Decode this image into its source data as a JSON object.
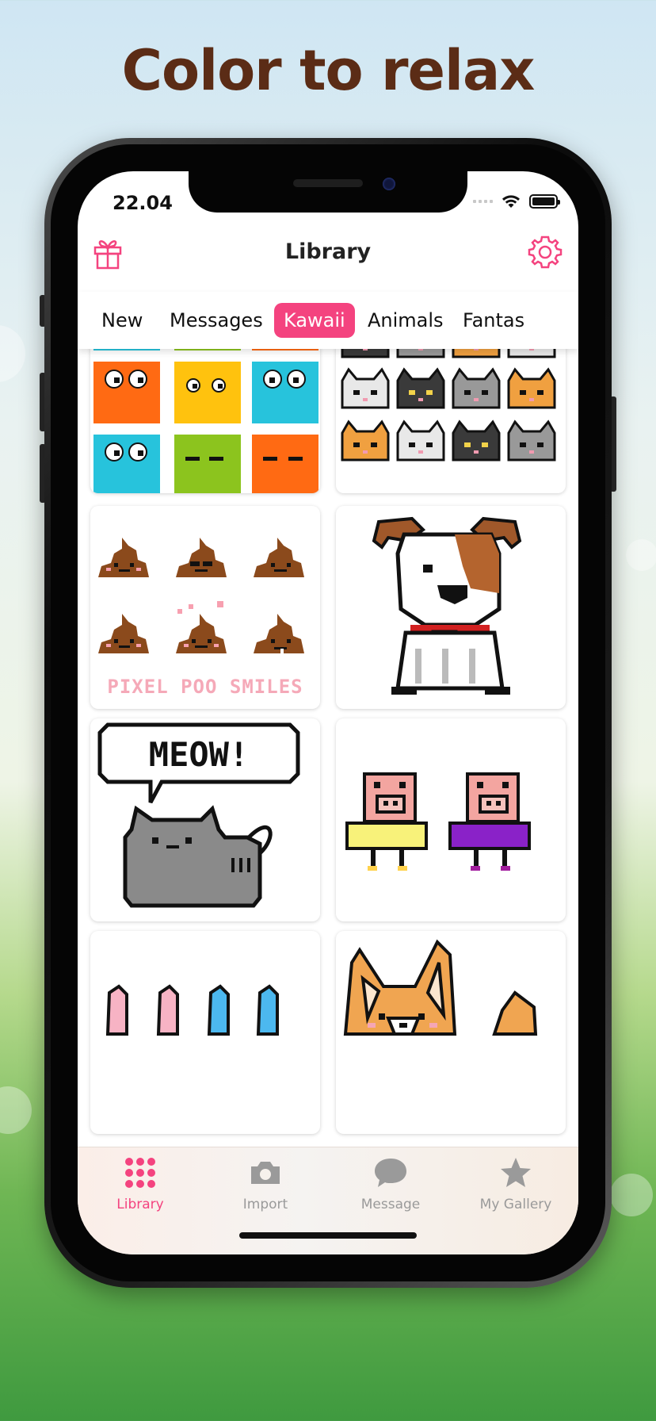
{
  "headline": "Color to relax",
  "status_bar": {
    "time": "22.04"
  },
  "nav": {
    "title": "Library",
    "gift_icon": "gift-icon",
    "settings_icon": "gear-icon"
  },
  "category_tabs": [
    {
      "label": "New",
      "active": false
    },
    {
      "label": "Messages",
      "active": false
    },
    {
      "label": "Kawaii",
      "active": true
    },
    {
      "label": "Animals",
      "active": false
    },
    {
      "label": "Fantas",
      "active": false
    }
  ],
  "artworks": [
    {
      "name": "pixel-blocks-faces"
    },
    {
      "name": "pixel-cats-grid"
    },
    {
      "name": "pixel-poo-smiles",
      "caption": "PIXEL POO SMILES"
    },
    {
      "name": "pixel-dog"
    },
    {
      "name": "pixel-cat-meow",
      "caption": "MEOW!"
    },
    {
      "name": "pixel-pigs"
    },
    {
      "name": "pixel-bunny-ears"
    },
    {
      "name": "pixel-corgi"
    }
  ],
  "tab_bar": [
    {
      "label": "Library",
      "icon": "grid-dots-icon",
      "active": true
    },
    {
      "label": "Import",
      "icon": "camera-icon",
      "active": false
    },
    {
      "label": "Message",
      "icon": "speech-bubble-icon",
      "active": false
    },
    {
      "label": "My Gallery",
      "icon": "star-icon",
      "active": false
    }
  ],
  "colors": {
    "accent": "#f4437f",
    "headline": "#5b2c16",
    "inactive": "#9a9a9a"
  }
}
